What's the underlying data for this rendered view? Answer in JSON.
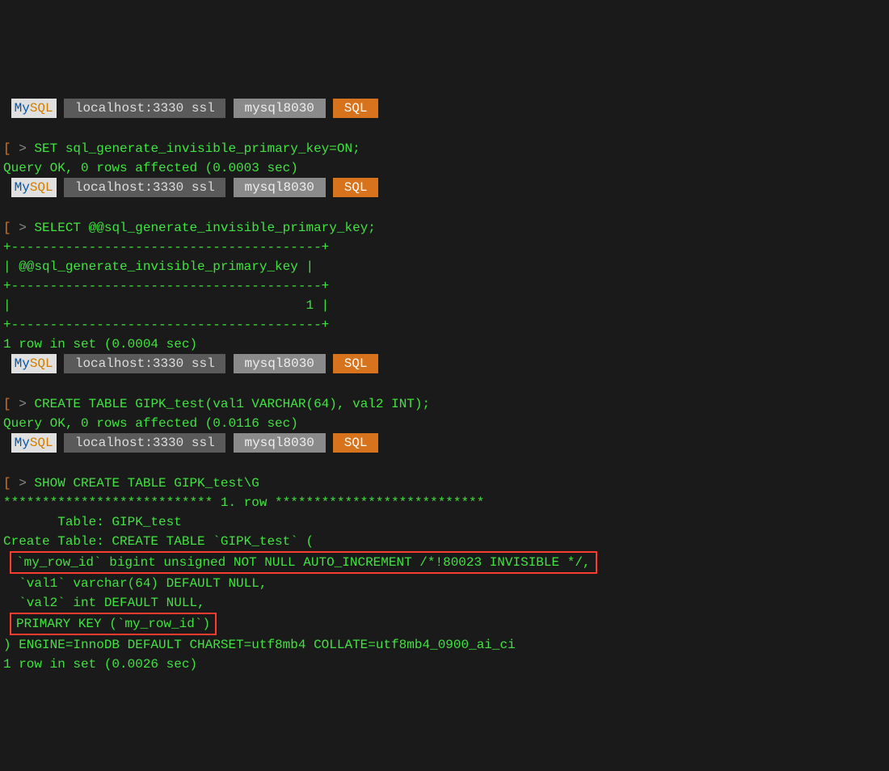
{
  "prompt": {
    "mysql_my": "My",
    "mysql_sql": "SQL",
    "host": " localhost:3330 ssl ",
    "db": " mysql8030 ",
    "mode": " SQL "
  },
  "lines": {
    "open_bracket": "[",
    "arrow": " > ",
    "cmd1": "SET sql_generate_invisible_primary_key=ON;",
    "resp1": "Query OK, 0 rows affected (0.0003 sec)",
    "cmd2": "SELECT @@sql_generate_invisible_primary_key;",
    "tbl_border": "+----------------------------------------+",
    "tbl_header": "| @@sql_generate_invisible_primary_key |",
    "tbl_value": "|                                      1 |",
    "resp2": "1 row in set (0.0004 sec)",
    "cmd3": "CREATE TABLE GIPK_test(val1 VARCHAR(64), val2 INT);",
    "resp3": "Query OK, 0 rows affected (0.0116 sec)",
    "cmd4": "SHOW CREATE TABLE GIPK_test\\G",
    "row_sep": "*************************** 1. row ***************************",
    "ct_table": "       Table: GIPK_test",
    "ct_create": "Create Table: CREATE TABLE `GIPK_test` (",
    "ct_rowid": "`my_row_id` bigint unsigned NOT NULL AUTO_INCREMENT /*!80023 INVISIBLE */,",
    "ct_val1": "  `val1` varchar(64) DEFAULT NULL,",
    "ct_val2": "  `val2` int DEFAULT NULL,",
    "ct_pk": "PRIMARY KEY (`my_row_id`)",
    "ct_end": ") ENGINE=InnoDB DEFAULT CHARSET=utf8mb4 COLLATE=utf8mb4_0900_ai_ci",
    "resp4": "1 row in set (0.0026 sec)"
  }
}
